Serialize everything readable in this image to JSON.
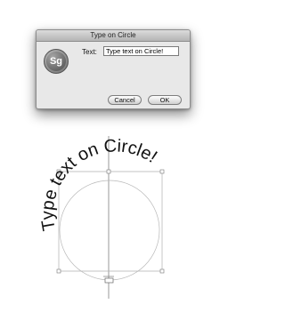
{
  "dialog": {
    "title": "Type on Circle",
    "icon_text": "Sg",
    "text_label": "Text:",
    "text_value": "Type text on Circle!",
    "cancel_label": "Cancel",
    "ok_label": "OK"
  },
  "canvas": {
    "curved_text": "Type text on Circle!"
  },
  "colors": {
    "dialog_bg": "#e8e8e8",
    "guide": "#9a9a9a",
    "text": "#111111"
  }
}
